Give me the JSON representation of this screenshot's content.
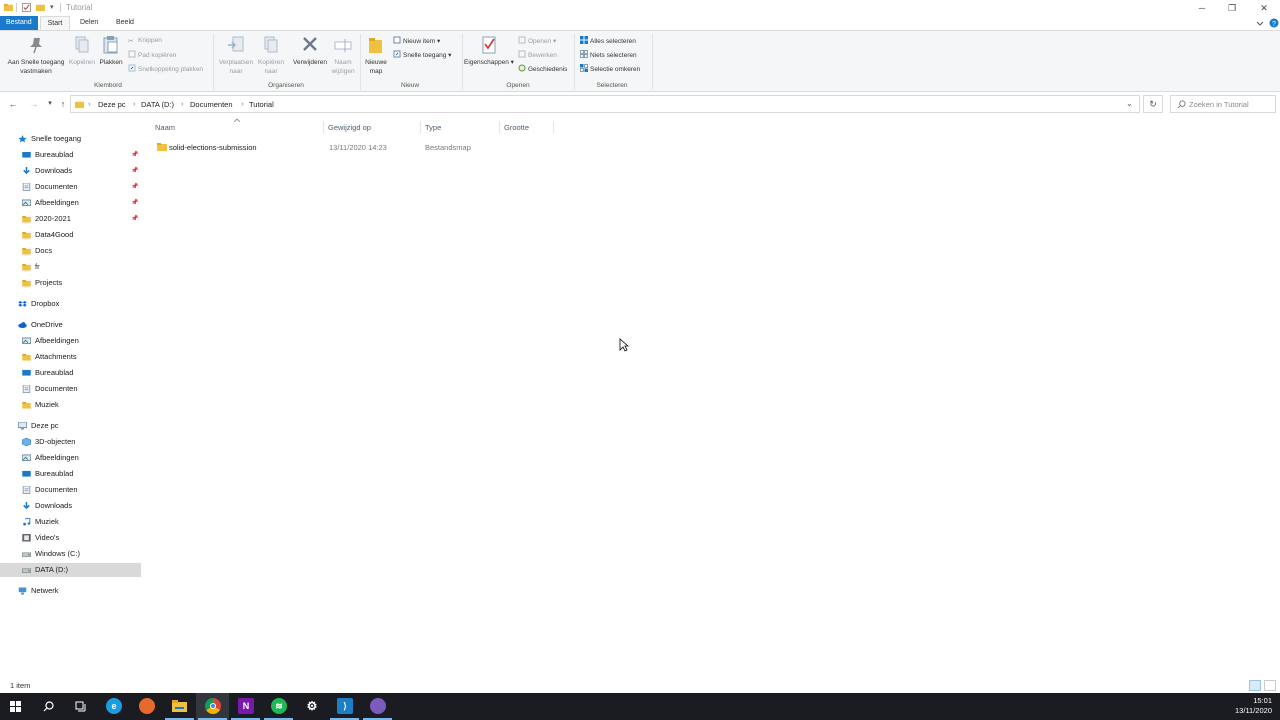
{
  "window": {
    "title": "Tutorial",
    "controls": {
      "minimize": "─",
      "maximize": "❐",
      "close": "✕"
    }
  },
  "ribbon_tabs": [
    {
      "label": "Bestand"
    },
    {
      "label": "Start"
    },
    {
      "label": "Delen"
    },
    {
      "label": "Beeld"
    }
  ],
  "ribbon": {
    "klembord": {
      "group_label": "Klembord",
      "pin_quick": "Aan Snelle toegang vastmaken",
      "copy": "Kopiëren",
      "paste": "Plakken",
      "cut": "Knippen",
      "copy_path": "Pad kopiëren",
      "paste_shortcut": "Snelkoppeling plakken"
    },
    "organiseren": {
      "group_label": "Organiseren",
      "move_to": "Verplaatsen naar",
      "copy_to": "Kopiëren naar",
      "delete": "Verwijderen",
      "rename": "Naam wijzigen"
    },
    "nieuw": {
      "group_label": "Nieuw",
      "new_folder": "Nieuwe map",
      "new_item": "Nieuw item",
      "easy_access": "Snelle toegang"
    },
    "openen": {
      "group_label": "Openen",
      "properties": "Eigenschappen",
      "open": "Openen",
      "edit": "Bewerken",
      "history": "Geschiedenis"
    },
    "selecteren": {
      "group_label": "Selecteren",
      "select_all": "Alles selecteren",
      "select_none": "Niets selecteren",
      "invert": "Selectie omkeren"
    }
  },
  "address": {
    "crumbs": [
      "Deze pc",
      "DATA (D:)",
      "Documenten",
      "Tutorial"
    ],
    "search_placeholder": "Zoeken in Tutorial"
  },
  "nav_pane": {
    "quick_access": "Snelle toegang",
    "quick_items": [
      "Bureaublad",
      "Downloads",
      "Documenten",
      "Afbeeldingen",
      "2020-2021",
      "Data4Good",
      "Docs",
      "fr",
      "Projects"
    ],
    "dropbox": "Dropbox",
    "onedrive": "OneDrive",
    "onedrive_items": [
      "Afbeeldingen",
      "Attachments",
      "Bureaublad",
      "Documenten",
      "Muziek"
    ],
    "this_pc": "Deze pc",
    "pc_items": [
      "3D-objecten",
      "Afbeeldingen",
      "Bureaublad",
      "Documenten",
      "Downloads",
      "Muziek",
      "Video's",
      "Windows (C:)",
      "DATA (D:)"
    ],
    "network": "Netwerk"
  },
  "columns": {
    "name": "Naam",
    "modified": "Gewijzigd op",
    "type": "Type",
    "size": "Grootte"
  },
  "files": [
    {
      "name": "solid-elections-submission",
      "modified": "13/11/2020 14:23",
      "type": "Bestandsmap",
      "size": ""
    }
  ],
  "status": {
    "item_count": "1 item"
  },
  "taskbar": {
    "time": "15:01",
    "date": "13/11/2020",
    "apps": [
      "start",
      "search",
      "task-view",
      "edge",
      "firefox",
      "file-explorer",
      "chrome",
      "onenote",
      "spotify",
      "settings",
      "vscode",
      "github-desktop"
    ]
  },
  "colors": {
    "accent": "#1979ca",
    "folder": "#f0c040",
    "taskbar": "#1a1c22"
  }
}
